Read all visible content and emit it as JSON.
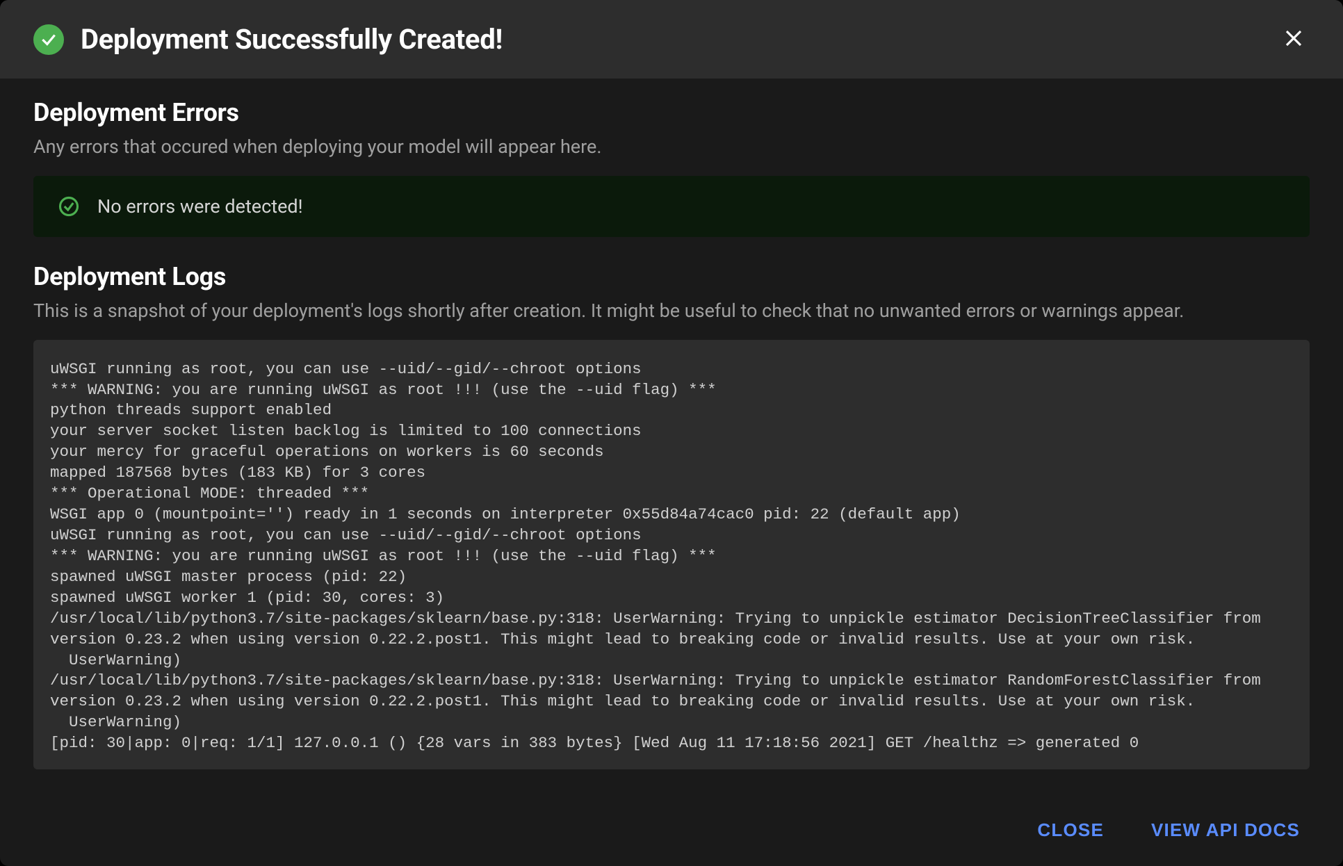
{
  "header": {
    "title": "Deployment Successfully Created!"
  },
  "errors": {
    "title": "Deployment Errors",
    "desc": "Any errors that occured when deploying your model will appear here.",
    "status_text": "No errors were detected!"
  },
  "logs": {
    "title": "Deployment Logs",
    "desc": "This is a snapshot of your deployment's logs shortly after creation. It might be useful to check that no unwanted errors or warnings appear.",
    "content": "uWSGI running as root, you can use --uid/--gid/--chroot options\n*** WARNING: you are running uWSGI as root !!! (use the --uid flag) ***\npython threads support enabled\nyour server socket listen backlog is limited to 100 connections\nyour mercy for graceful operations on workers is 60 seconds\nmapped 187568 bytes (183 KB) for 3 cores\n*** Operational MODE: threaded ***\nWSGI app 0 (mountpoint='') ready in 1 seconds on interpreter 0x55d84a74cac0 pid: 22 (default app)\nuWSGI running as root, you can use --uid/--gid/--chroot options\n*** WARNING: you are running uWSGI as root !!! (use the --uid flag) ***\nspawned uWSGI master process (pid: 22)\nspawned uWSGI worker 1 (pid: 30, cores: 3)\n/usr/local/lib/python3.7/site-packages/sklearn/base.py:318: UserWarning: Trying to unpickle estimator DecisionTreeClassifier from version 0.23.2 when using version 0.22.2.post1. This might lead to breaking code or invalid results. Use at your own risk.\n  UserWarning)\n/usr/local/lib/python3.7/site-packages/sklearn/base.py:318: UserWarning: Trying to unpickle estimator RandomForestClassifier from version 0.23.2 when using version 0.22.2.post1. This might lead to breaking code or invalid results. Use at your own risk.\n  UserWarning)\n[pid: 30|app: 0|req: 1/1] 127.0.0.1 () {28 vars in 383 bytes} [Wed Aug 11 17:18:56 2021] GET /healthz => generated 0"
  },
  "footer": {
    "close_label": "CLOSE",
    "docs_label": "VIEW API DOCS"
  }
}
